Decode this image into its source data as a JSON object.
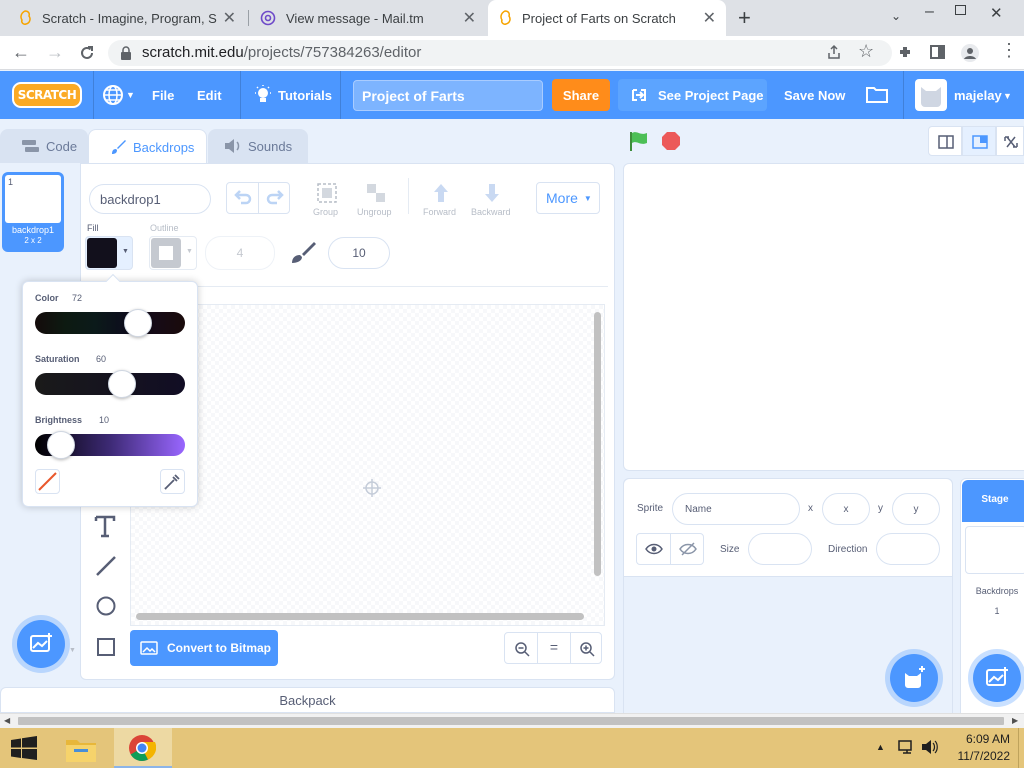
{
  "browser": {
    "tabs": [
      {
        "title": "Scratch - Imagine, Program, Shar",
        "icon": "scratch-favicon-icon"
      },
      {
        "title": "View message - Mail.tm",
        "icon": "mailtm-favicon-icon"
      },
      {
        "title": "Project of Farts on Scratch",
        "icon": "scratch-favicon-icon",
        "active": true
      }
    ],
    "url_host": "scratch.mit.edu",
    "url_path": "/projects/757384263/editor"
  },
  "menubar": {
    "logo": "SCRATCH",
    "file": "File",
    "edit": "Edit",
    "tutorials": "Tutorials",
    "project_title": "Project of Farts",
    "share": "Share",
    "see_project_page": "See Project Page",
    "save_now": "Save Now",
    "username": "majelay"
  },
  "editor_tabs": {
    "code": "Code",
    "backdrops": "Backdrops",
    "sounds": "Sounds"
  },
  "backdrop_list": [
    {
      "index": "1",
      "name": "backdrop1",
      "size": "2 x 2"
    }
  ],
  "paint": {
    "costume_name": "backdrop1",
    "group": "Group",
    "ungroup": "Ungroup",
    "forward": "Forward",
    "backward": "Backward",
    "more": "More",
    "fill_label": "Fill",
    "outline_label": "Outline",
    "outline_width": "4",
    "brush_size": "10",
    "convert_bitmap": "Convert to Bitmap",
    "zoom_reset": "="
  },
  "color_picker": {
    "color_label": "Color",
    "color_value": "72",
    "saturation_label": "Saturation",
    "saturation_value": "60",
    "brightness_label": "Brightness",
    "brightness_value": "10"
  },
  "sprite_info": {
    "sprite_label": "Sprite",
    "name_placeholder": "Name",
    "x_label": "x",
    "x_placeholder": "x",
    "y_label": "y",
    "y_placeholder": "y",
    "size_label": "Size",
    "direction_label": "Direction"
  },
  "stage_panel": {
    "title": "Stage",
    "backdrops_label": "Backdrops",
    "backdrops_count": "1"
  },
  "backpack": "Backpack",
  "taskbar": {
    "time": "6:09 AM",
    "date": "11/7/2022"
  },
  "colors": {
    "scratch_blue": "#4c97ff",
    "share_orange": "#ff8c1a",
    "fill_color": "#12101c",
    "taskbar": "#e4c57a"
  }
}
